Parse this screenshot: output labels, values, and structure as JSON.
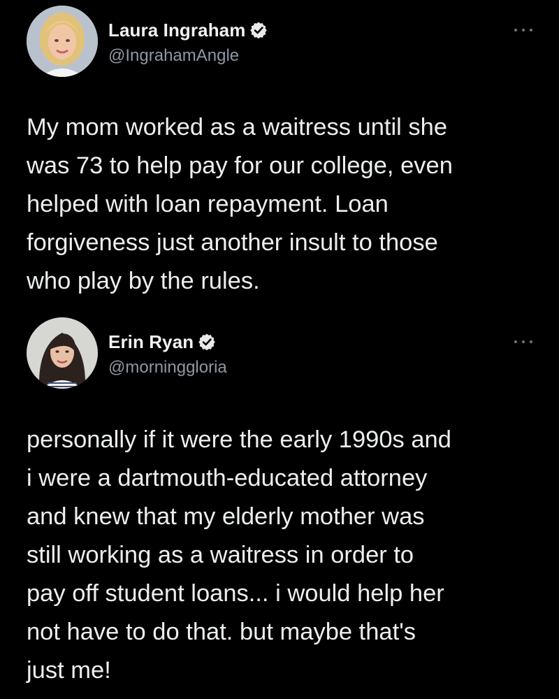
{
  "colors": {
    "background": "#000000",
    "text": "#eceeef",
    "secondary_text": "#8b98a5",
    "verified_badge": "#e7e9ea"
  },
  "tweets": [
    {
      "display_name": "Laura Ingraham",
      "handle": "@IngrahamAngle",
      "verified": true,
      "avatar_icon": "avatar-photo-blonde-woman",
      "more_icon": "more-options-icon",
      "text": "My mom worked as a waitress until she\nwas 73 to help pay for our college, even\nhelped with loan repayment. Loan\nforgiveness just another insult to those\nwho play by the rules."
    },
    {
      "display_name": "Erin Ryan",
      "handle": "@morninggloria",
      "verified": true,
      "avatar_icon": "avatar-photo-dark-haired-woman",
      "more_icon": "more-options-icon",
      "text": "personally if it were the early 1990s and\ni were a dartmouth-educated attorney\nand knew that my elderly mother was\nstill working as a waitress in order to\npay off student loans... i would help her\nnot have to do that. but maybe that's\njust me!"
    }
  ]
}
